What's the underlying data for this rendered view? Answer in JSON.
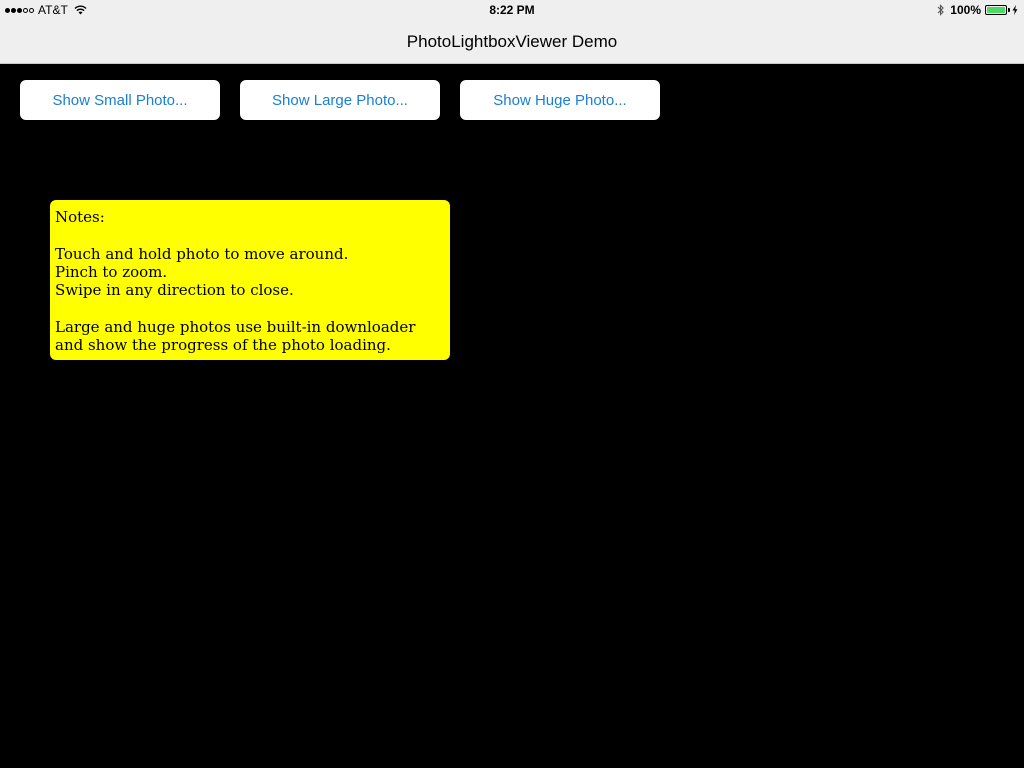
{
  "status_bar": {
    "signal_icon": "signal-dots-icon",
    "signal_bars_filled": 3,
    "signal_bars_total": 5,
    "carrier": "AT&T",
    "wifi_icon": "wifi-icon",
    "time": "8:22 PM",
    "bluetooth_icon": "bluetooth-icon",
    "battery_percent": "100%",
    "battery_level": 1.0,
    "battery_icon": "battery-icon",
    "charging_icon": "charging-bolt-icon",
    "battery_color": "#4cd964"
  },
  "nav": {
    "title": "PhotoLightboxViewer Demo",
    "background": "#efefef"
  },
  "buttons": {
    "small": "Show Small Photo...",
    "large": "Show Large Photo...",
    "huge": "Show Huge Photo...",
    "text_color": "#1a7fd1"
  },
  "notes": {
    "heading": "Notes:",
    "lines_block1": [
      "Touch and hold photo to move around.",
      "Pinch to zoom.",
      "Swipe in any direction to close."
    ],
    "lines_block2": [
      "Large and huge photos use built-in downloader",
      "and show the progress of the photo loading."
    ],
    "background": "#ffff00"
  },
  "colors": {
    "page_background": "#000000"
  }
}
